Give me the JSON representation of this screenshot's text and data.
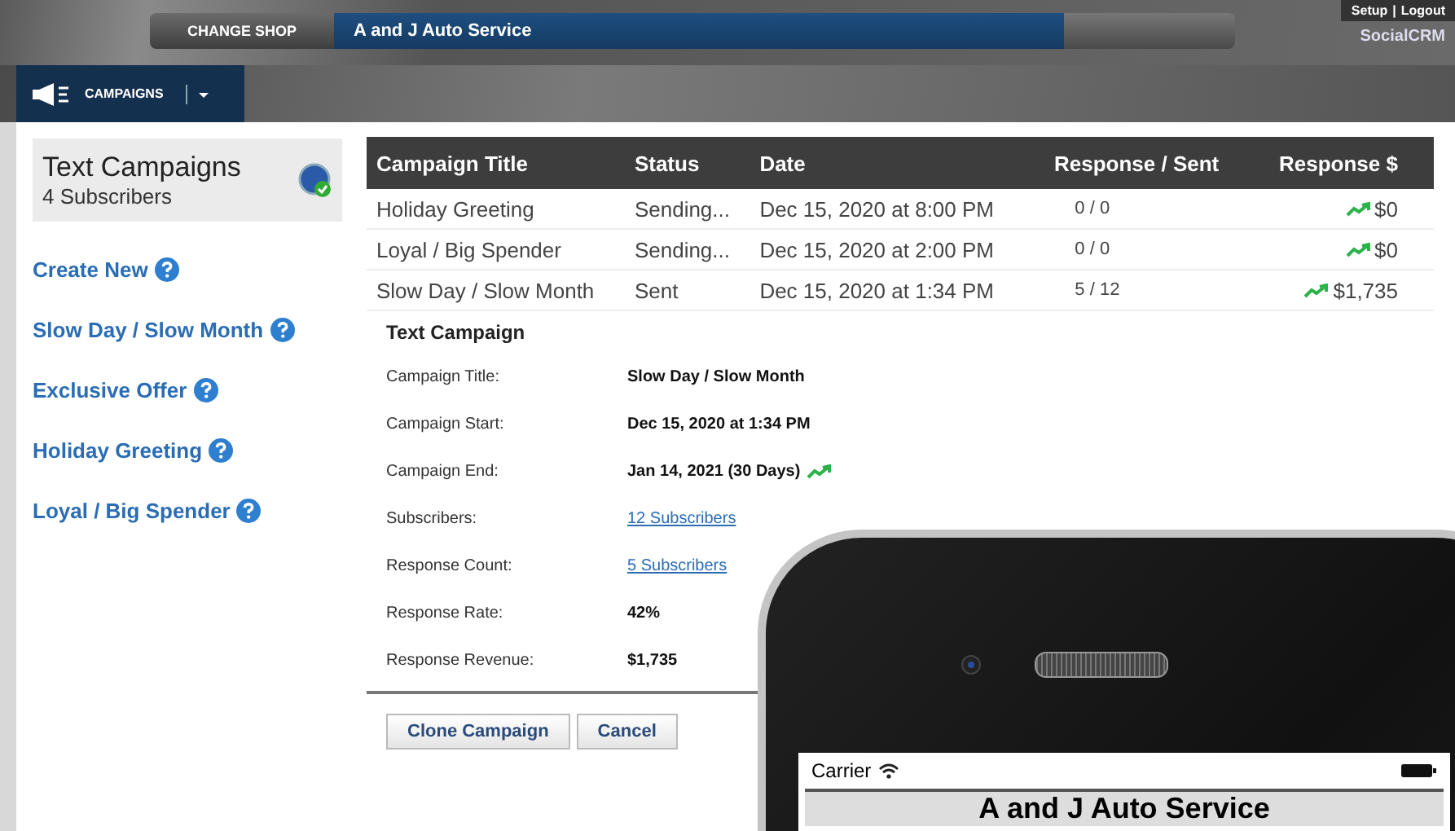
{
  "header": {
    "change_shop": "CHANGE SHOP",
    "shop_name": "A and J Auto Service",
    "links": [
      "Setup",
      "Logout"
    ],
    "link_separator": "|",
    "product": "SocialCRM"
  },
  "nav": {
    "label": "CAMPAIGNS"
  },
  "sidebar": {
    "title": "Text Campaigns",
    "subtitle": "4 Subscribers",
    "items": [
      "Create New",
      "Slow Day / Slow Month",
      "Exclusive Offer",
      "Holiday Greeting",
      "Loyal / Big Spender"
    ]
  },
  "table": {
    "columns": [
      "Campaign Title",
      "Status",
      "Date",
      "Response / Sent",
      "Response $"
    ],
    "rows": [
      {
        "title": "Holiday Greeting",
        "status": "Sending...",
        "date": "Dec 15, 2020 at 8:00 PM",
        "response_sent": "0 / 0",
        "revenue": "$0"
      },
      {
        "title": "Loyal / Big Spender",
        "status": "Sending...",
        "date": "Dec 15, 2020 at 2:00 PM",
        "response_sent": "0 / 0",
        "revenue": "$0"
      },
      {
        "title": "Slow Day / Slow Month",
        "status": "Sent",
        "date": "Dec 15, 2020 at 1:34 PM",
        "response_sent": "5 / 12",
        "revenue": "$1,735"
      }
    ]
  },
  "detail": {
    "title": "Text Campaign",
    "fields": [
      {
        "label": "Campaign Title:",
        "value": "Slow Day / Slow Month",
        "kind": "text",
        "trend": false
      },
      {
        "label": "Campaign Start:",
        "value": "Dec 15, 2020 at 1:34 PM",
        "kind": "text",
        "trend": false
      },
      {
        "label": "Campaign End:",
        "value": "Jan 14, 2021 (30 Days)",
        "kind": "text",
        "trend": true
      },
      {
        "label": "Subscribers:",
        "value": "12 Subscribers",
        "kind": "link",
        "trend": false
      },
      {
        "label": "Response Count:",
        "value": "5 Subscribers",
        "kind": "link",
        "trend": false
      },
      {
        "label": "Response Rate:",
        "value": "42%",
        "kind": "text",
        "trend": false
      },
      {
        "label": "Response Revenue:",
        "value": "$1,735",
        "kind": "text",
        "trend": false
      }
    ],
    "buttons": [
      "Clone Campaign",
      "Cancel"
    ]
  },
  "phone": {
    "carrier": "Carrier",
    "app_title": "A and J Auto Service"
  }
}
